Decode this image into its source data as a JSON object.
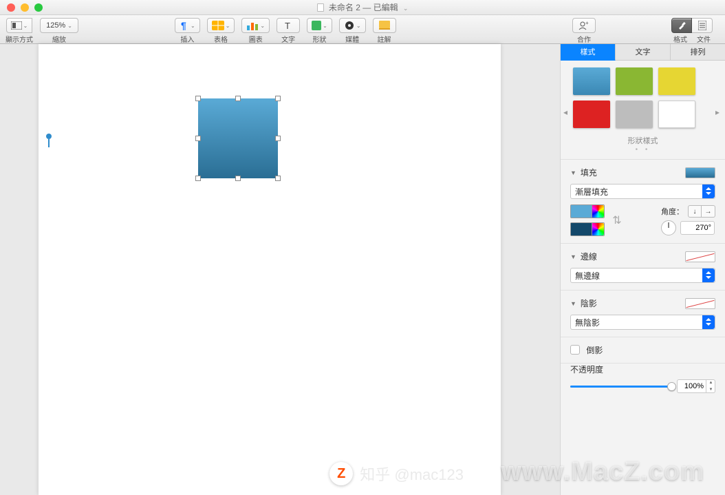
{
  "title": {
    "docname": "未命名 2",
    "state": "已編輯"
  },
  "toolbar": {
    "view": "顯示方式",
    "zoom_value": "125%",
    "zoom_label": "縮放",
    "insert": "插入",
    "table": "表格",
    "chart": "圖表",
    "text": "文字",
    "shape": "形狀",
    "media": "媒體",
    "comment": "註解",
    "collab": "合作",
    "format": "格式",
    "document": "文件"
  },
  "inspector": {
    "tabs": {
      "style": "樣式",
      "text": "文字",
      "arrange": "排列"
    },
    "shape_styles_label": "形狀樣式",
    "fill": {
      "title": "填充",
      "mode": "漸層填充",
      "angle_label": "角度：",
      "angle_value": "270°",
      "colors": {
        "c1": "#5aaad6",
        "c2": "#13486a"
      }
    },
    "border": {
      "title": "邊線",
      "mode": "無邊線"
    },
    "shadow": {
      "title": "陰影",
      "mode": "無陰影"
    },
    "reflection": {
      "label": "倒影"
    },
    "opacity": {
      "label": "不透明度",
      "value": "100%"
    }
  },
  "watermark": {
    "zhihu": "知乎 @mac123",
    "site": "www.MacZ.com"
  }
}
